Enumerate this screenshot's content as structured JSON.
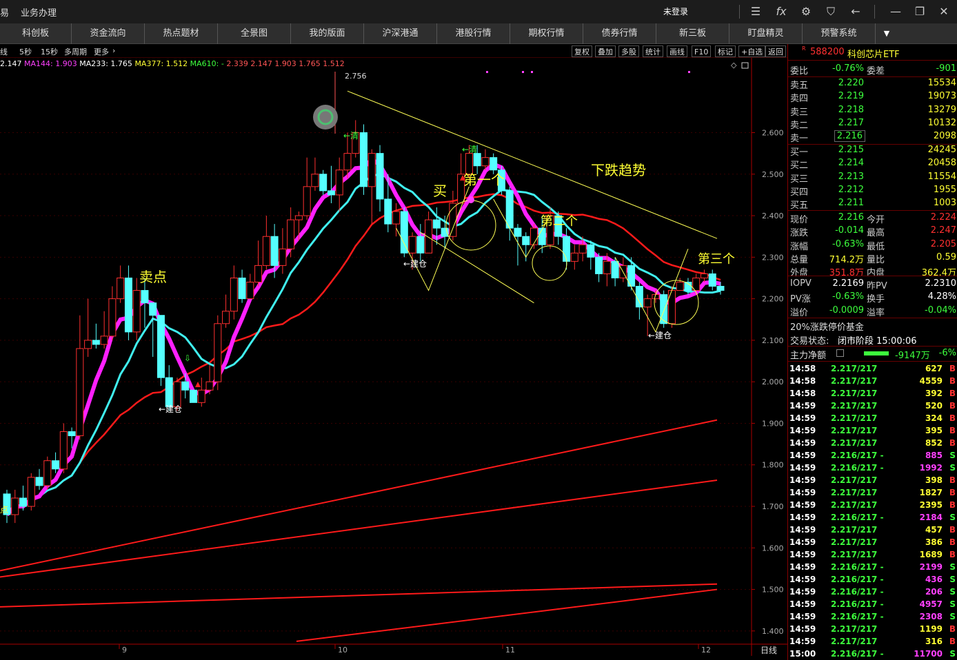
{
  "titlebar": {
    "menu": [
      "易",
      "业务办理"
    ],
    "status": "未登录",
    "fx": "fx"
  },
  "nav": [
    "科创板",
    "资金流向",
    "热点题材",
    "全景图",
    "我的版面",
    "沪深港通",
    "港股行情",
    "期权行情",
    "债券行情",
    "新三板",
    "盯盘精灵",
    "预警系统"
  ],
  "toolbar": {
    "periods": [
      "线",
      "5秒",
      "15秒",
      "多周期",
      "更多"
    ],
    "right": [
      "复权",
      "叠加",
      "多股",
      "统计",
      "画线",
      "F10",
      "标记",
      "+自选",
      "返回"
    ]
  },
  "ma_line": {
    "prefix": "2.147",
    "ma144": "MA144: 1.903",
    "ma233": "MA233: 1.765",
    "ma377": "MA377: 1.512",
    "ma610": "MA610: -",
    "extra": "2.339 2.147 1.903 1.765 1.512"
  },
  "chart_data": {
    "type": "candlestick",
    "y_ticks": [
      "2.600",
      "2.500",
      "2.400",
      "2.300",
      "2.200",
      "2.100",
      "2.000",
      "1.900",
      "1.800",
      "1.700",
      "1.600",
      "1.500",
      "1.400"
    ],
    "y_range": [
      1.34,
      2.78
    ],
    "x_labels": [
      "9",
      "10",
      "11",
      "12"
    ],
    "period_label": "日线",
    "high_marker": "2.756",
    "candles": [
      [
        1.73,
        1.68,
        1.74,
        1.66
      ],
      [
        1.68,
        1.72,
        1.74,
        1.66
      ],
      [
        1.72,
        1.7,
        1.75,
        1.69
      ],
      [
        1.7,
        1.77,
        1.78,
        1.69
      ],
      [
        1.77,
        1.75,
        1.79,
        1.74
      ],
      [
        1.75,
        1.81,
        1.82,
        1.74
      ],
      [
        1.81,
        1.79,
        1.83,
        1.78
      ],
      [
        1.79,
        1.88,
        1.9,
        1.78
      ],
      [
        1.88,
        1.87,
        1.89,
        1.84
      ],
      [
        1.87,
        2.08,
        2.16,
        1.86
      ],
      [
        2.08,
        2.1,
        2.2,
        2.06
      ],
      [
        2.1,
        2.09,
        2.14,
        2.08
      ],
      [
        2.09,
        2.11,
        2.17,
        2.08
      ],
      [
        2.11,
        2.2,
        2.23,
        2.1
      ],
      [
        2.2,
        2.25,
        2.28,
        2.19
      ],
      [
        2.25,
        2.12,
        2.28,
        2.1
      ],
      [
        2.12,
        2.22,
        2.25,
        2.1
      ],
      [
        2.22,
        2.19,
        2.25,
        2.13
      ],
      [
        2.19,
        2.16,
        2.18,
        2.06
      ],
      [
        2.16,
        2.01,
        2.16,
        1.99
      ],
      [
        2.01,
        1.94,
        2.04,
        1.93
      ],
      [
        1.94,
        2.0,
        2.01,
        1.93
      ],
      [
        2.0,
        1.98,
        2.02,
        1.96
      ],
      [
        1.98,
        1.95,
        1.98,
        1.95
      ],
      [
        1.95,
        1.98,
        2.01,
        1.94
      ],
      [
        1.98,
        2.0,
        2.04,
        1.97
      ],
      [
        2.0,
        2.14,
        2.16,
        1.98
      ],
      [
        2.14,
        2.17,
        2.21,
        2.13
      ],
      [
        2.17,
        2.25,
        2.28,
        2.15
      ],
      [
        2.25,
        2.2,
        2.27,
        2.19
      ],
      [
        2.2,
        2.24,
        2.26,
        2.2
      ],
      [
        2.24,
        2.28,
        2.34,
        2.23
      ],
      [
        2.28,
        2.35,
        2.4,
        2.27
      ],
      [
        2.35,
        2.28,
        2.38,
        2.25
      ],
      [
        2.28,
        2.32,
        2.37,
        2.26
      ],
      [
        2.32,
        2.39,
        2.42,
        2.3
      ],
      [
        2.39,
        2.4,
        2.41,
        2.34
      ],
      [
        2.4,
        2.47,
        2.54,
        2.39
      ],
      [
        2.47,
        2.5,
        2.54,
        2.46
      ],
      [
        2.5,
        2.46,
        2.51,
        2.45
      ],
      [
        2.46,
        2.45,
        2.52,
        2.43
      ],
      [
        2.45,
        2.51,
        2.54,
        2.41
      ],
      [
        2.51,
        2.55,
        2.6,
        2.49
      ],
      [
        2.55,
        2.6,
        2.63,
        2.54
      ],
      [
        2.6,
        2.47,
        2.62,
        2.45
      ],
      [
        2.47,
        2.55,
        2.56,
        2.38
      ],
      [
        2.55,
        2.44,
        2.57,
        2.41
      ],
      [
        2.44,
        2.38,
        2.5,
        2.36
      ],
      [
        2.38,
        2.41,
        2.43,
        2.35
      ],
      [
        2.41,
        2.31,
        2.42,
        2.3
      ],
      [
        2.31,
        2.35,
        2.36,
        2.27
      ],
      [
        2.35,
        2.31,
        2.38,
        2.29
      ],
      [
        2.31,
        2.39,
        2.41,
        2.32
      ],
      [
        2.39,
        2.37,
        2.42,
        2.33
      ],
      [
        2.37,
        2.35,
        2.4,
        2.32
      ],
      [
        2.35,
        2.43,
        2.46,
        2.34
      ],
      [
        2.43,
        2.5,
        2.55,
        2.43
      ],
      [
        2.5,
        2.55,
        2.57,
        2.49
      ],
      [
        2.55,
        2.52,
        2.57,
        2.5
      ],
      [
        2.52,
        2.54,
        2.56,
        2.51
      ],
      [
        2.54,
        2.51,
        2.55,
        2.5
      ],
      [
        2.51,
        2.46,
        2.52,
        2.45
      ],
      [
        2.46,
        2.37,
        2.47,
        2.34
      ],
      [
        2.37,
        2.35,
        2.38,
        2.28
      ],
      [
        2.35,
        2.33,
        2.36,
        2.29
      ],
      [
        2.33,
        2.37,
        2.38,
        2.32
      ],
      [
        2.37,
        2.33,
        2.4,
        2.31
      ],
      [
        2.33,
        2.4,
        2.42,
        2.32
      ],
      [
        2.4,
        2.35,
        2.41,
        2.33
      ],
      [
        2.35,
        2.29,
        2.37,
        2.27
      ],
      [
        2.29,
        2.31,
        2.33,
        2.27
      ],
      [
        2.31,
        2.33,
        2.35,
        2.29
      ],
      [
        2.33,
        2.3,
        2.34,
        2.27
      ],
      [
        2.3,
        2.26,
        2.31,
        2.24
      ],
      [
        2.26,
        2.29,
        2.31,
        2.23
      ],
      [
        2.29,
        2.25,
        2.3,
        2.23
      ],
      [
        2.25,
        2.28,
        2.3,
        2.24
      ],
      [
        2.28,
        2.23,
        2.3,
        2.22
      ],
      [
        2.23,
        2.18,
        2.24,
        2.15
      ],
      [
        2.18,
        2.2,
        2.21,
        2.11
      ],
      [
        2.2,
        2.21,
        2.22,
        2.19
      ],
      [
        2.21,
        2.14,
        2.22,
        2.13
      ],
      [
        2.14,
        2.22,
        2.23,
        2.13
      ],
      [
        2.22,
        2.24,
        2.25,
        2.22
      ],
      [
        2.24,
        2.22,
        2.25,
        2.21
      ],
      [
        2.22,
        2.25,
        2.26,
        2.22
      ],
      [
        2.25,
        2.26,
        2.27,
        2.24
      ],
      [
        2.26,
        2.23,
        2.27,
        2.22
      ],
      [
        2.23,
        2.22,
        2.24,
        2.21
      ]
    ],
    "annotations": [
      "卖点",
      "买",
      "第一个",
      "第二个",
      "第三个",
      "下跌趋势",
      "←清",
      "←清",
      "←建仓",
      "←建仓",
      "←建仓",
      "点"
    ]
  },
  "panel": {
    "badge": "R",
    "code": "588200",
    "name": "科创芯片ETF",
    "weibi": {
      "label": "委比",
      "value": "-0.76%",
      "label2": "委差",
      "value2": "-901"
    },
    "asks": [
      {
        "label": "卖五",
        "price": "2.220",
        "vol": "15534"
      },
      {
        "label": "卖四",
        "price": "2.219",
        "vol": "19073"
      },
      {
        "label": "卖三",
        "price": "2.218",
        "vol": "13279"
      },
      {
        "label": "卖二",
        "price": "2.217",
        "vol": "10132"
      },
      {
        "label": "卖一",
        "price": "2.216",
        "vol": "2098"
      }
    ],
    "bids": [
      {
        "label": "买一",
        "price": "2.215",
        "vol": "24245"
      },
      {
        "label": "买二",
        "price": "2.214",
        "vol": "20458"
      },
      {
        "label": "买三",
        "price": "2.213",
        "vol": "11554"
      },
      {
        "label": "买四",
        "price": "2.212",
        "vol": "1955"
      },
      {
        "label": "买五",
        "price": "2.211",
        "vol": "1003"
      }
    ],
    "stats": [
      {
        "l1": "现价",
        "v1": "2.216",
        "l2": "今开",
        "v2": "2.224"
      },
      {
        "l1": "涨跌",
        "v1": "-0.014",
        "l2": "最高",
        "v2": "2.247"
      },
      {
        "l1": "涨幅",
        "v1": "-0.63%",
        "l2": "最低",
        "v2": "2.205"
      },
      {
        "l1": "总量",
        "v1": "714.2万",
        "l2": "量比",
        "v2": "0.59"
      },
      {
        "l1": "外盘",
        "v1": "351.8万",
        "l2": "内盘",
        "v2": "362.4万"
      }
    ],
    "iopv": [
      {
        "l1": "IOPV",
        "v1": "2.2169",
        "l2": "昨PV",
        "v2": "2.2310"
      },
      {
        "l1": "PV涨",
        "v1": "-0.63%",
        "l2": "换手",
        "v2": "4.28%"
      },
      {
        "l1": "溢价",
        "v1": "-0.0009",
        "l2": "溢率",
        "v2": "-0.04%"
      }
    ],
    "limit_type": "20%涨跌停价基金",
    "trade_status": {
      "label": "交易状态:",
      "value": "闭市阶段 15:00:06"
    },
    "main_net": {
      "label": "主力净额",
      "value": "-9147万",
      "pct": "-6%"
    },
    "ticks": [
      {
        "t": "14:58",
        "p": "2.217/217",
        "v": "627",
        "s": "B"
      },
      {
        "t": "14:58",
        "p": "2.217/217",
        "v": "4559",
        "s": "B"
      },
      {
        "t": "14:58",
        "p": "2.217/217",
        "v": "392",
        "s": "B"
      },
      {
        "t": "14:59",
        "p": "2.217/217",
        "v": "520",
        "s": "B"
      },
      {
        "t": "14:59",
        "p": "2.217/217",
        "v": "324",
        "s": "B"
      },
      {
        "t": "14:59",
        "p": "2.217/217",
        "v": "395",
        "s": "B"
      },
      {
        "t": "14:59",
        "p": "2.217/217",
        "v": "852",
        "s": "B"
      },
      {
        "t": "14:59",
        "p": "2.216/217 -",
        "v": "885",
        "s": "S"
      },
      {
        "t": "14:59",
        "p": "2.216/217 -",
        "v": "1992",
        "s": "S"
      },
      {
        "t": "14:59",
        "p": "2.217/217",
        "v": "398",
        "s": "B"
      },
      {
        "t": "14:59",
        "p": "2.217/217",
        "v": "1827",
        "s": "B"
      },
      {
        "t": "14:59",
        "p": "2.217/217",
        "v": "2395",
        "s": "B"
      },
      {
        "t": "14:59",
        "p": "2.216/217 -",
        "v": "2184",
        "s": "S"
      },
      {
        "t": "14:59",
        "p": "2.217/217",
        "v": "457",
        "s": "B"
      },
      {
        "t": "14:59",
        "p": "2.217/217",
        "v": "386",
        "s": "B"
      },
      {
        "t": "14:59",
        "p": "2.217/217",
        "v": "1689",
        "s": "B"
      },
      {
        "t": "14:59",
        "p": "2.216/217 -",
        "v": "2199",
        "s": "S"
      },
      {
        "t": "14:59",
        "p": "2.216/217 -",
        "v": "436",
        "s": "S"
      },
      {
        "t": "14:59",
        "p": "2.216/217 -",
        "v": "206",
        "s": "S"
      },
      {
        "t": "14:59",
        "p": "2.216/217 -",
        "v": "4957",
        "s": "S"
      },
      {
        "t": "14:59",
        "p": "2.216/217 -",
        "v": "2308",
        "s": "S"
      },
      {
        "t": "14:59",
        "p": "2.217/217",
        "v": "1199",
        "s": "B"
      },
      {
        "t": "14:59",
        "p": "2.217/217",
        "v": "316",
        "s": "B"
      },
      {
        "t": "15:00",
        "p": "2.216/217 -",
        "v": "11700",
        "s": "S"
      }
    ]
  },
  "colors": {
    "up": "#ff3030",
    "down": "#55ffff",
    "accent": "#ffff33",
    "ma_magenta": "#ff20ff",
    "ma_cyan": "#40f0f0",
    "ma_red": "#ff1a1a"
  }
}
